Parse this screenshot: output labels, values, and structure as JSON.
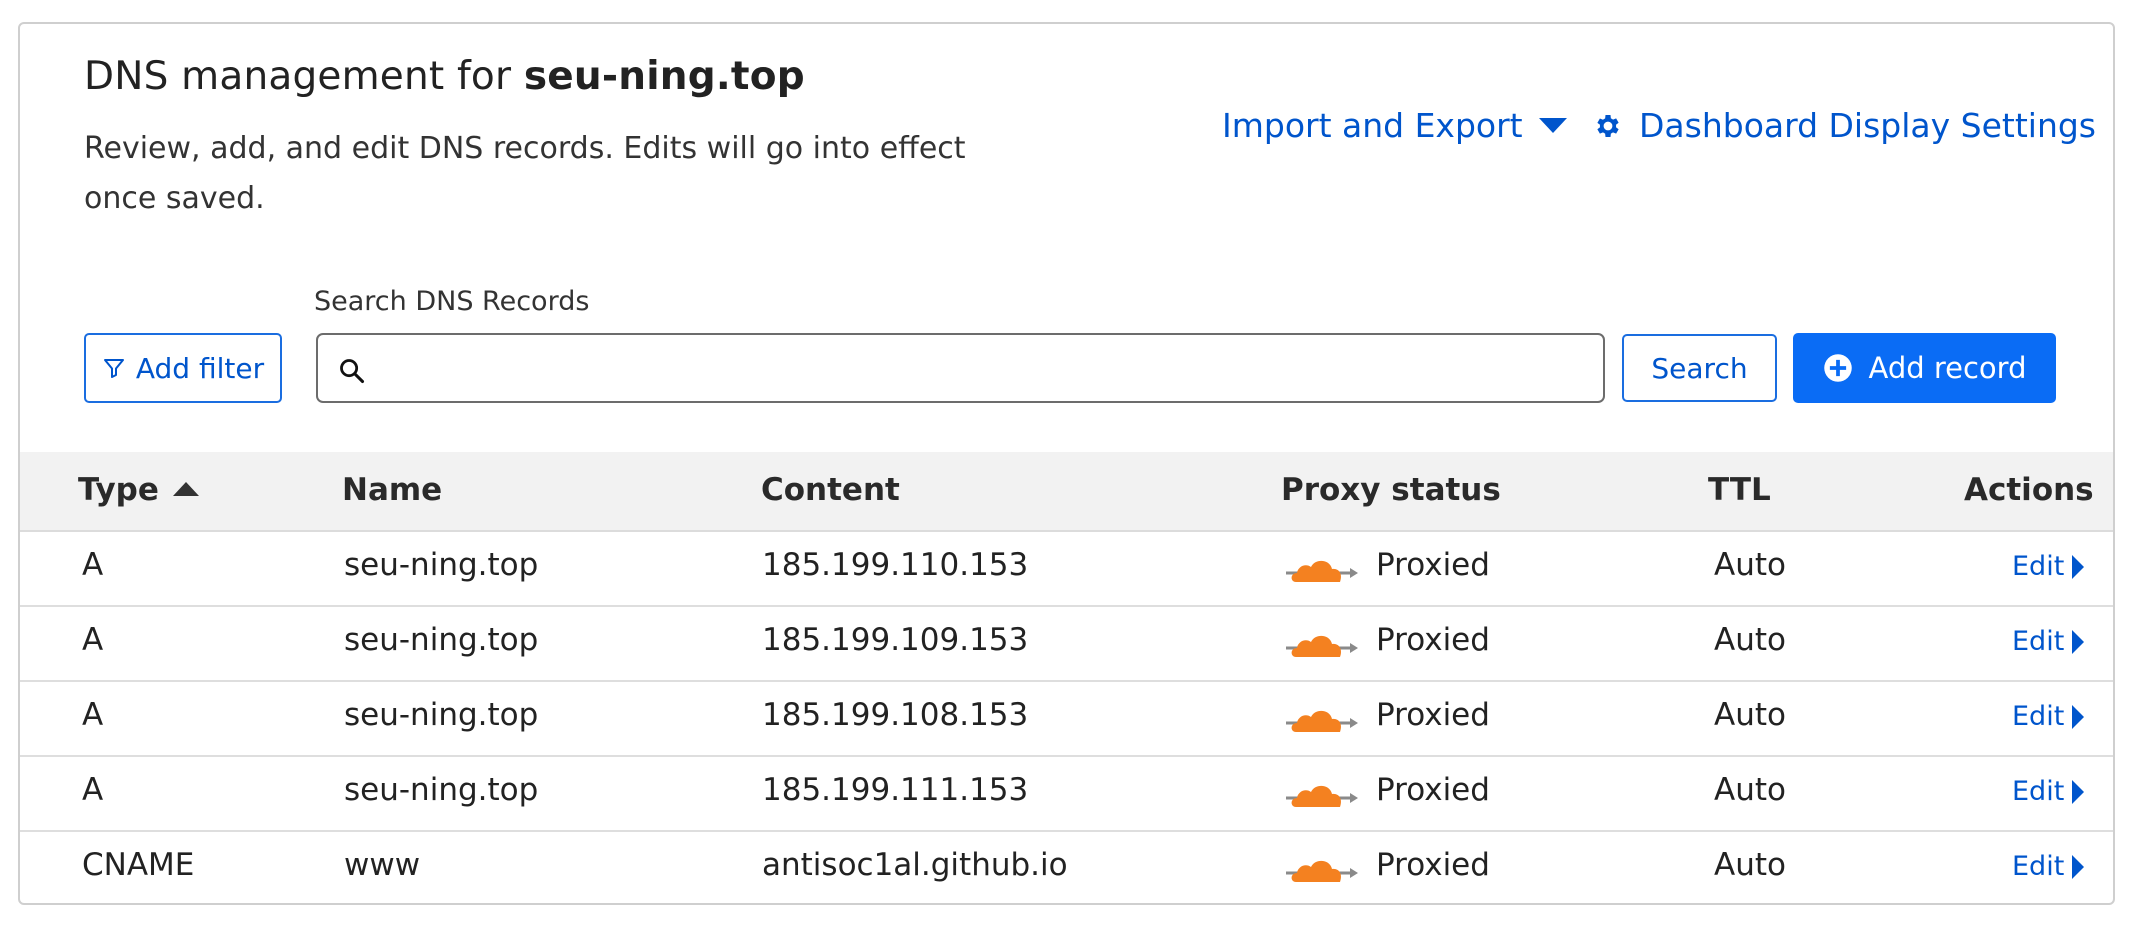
{
  "header": {
    "title_prefix": "DNS management for ",
    "domain": "seu-ning.top",
    "description": "Review, add, and edit DNS records. Edits will go into effect once saved."
  },
  "top_links": {
    "import_export": "Import and Export",
    "dashboard_settings": "Dashboard Display Settings"
  },
  "toolbar": {
    "add_filter": "Add filter",
    "search_label": "Search DNS Records",
    "search_value": "",
    "search_button": "Search",
    "add_record": "Add record"
  },
  "table": {
    "columns": {
      "type": "Type",
      "name": "Name",
      "content": "Content",
      "proxy_status": "Proxy status",
      "ttl": "TTL",
      "actions": "Actions"
    },
    "sort_column": "type",
    "sort_direction": "ascending",
    "rows": [
      {
        "type": "A",
        "name": "seu-ning.top",
        "content": "185.199.110.153",
        "proxy": "Proxied",
        "ttl": "Auto",
        "action": "Edit"
      },
      {
        "type": "A",
        "name": "seu-ning.top",
        "content": "185.199.109.153",
        "proxy": "Proxied",
        "ttl": "Auto",
        "action": "Edit"
      },
      {
        "type": "A",
        "name": "seu-ning.top",
        "content": "185.199.108.153",
        "proxy": "Proxied",
        "ttl": "Auto",
        "action": "Edit"
      },
      {
        "type": "A",
        "name": "seu-ning.top",
        "content": "185.199.111.153",
        "proxy": "Proxied",
        "ttl": "Auto",
        "action": "Edit"
      },
      {
        "type": "CNAME",
        "name": "www",
        "content": "antisoc1al.github.io",
        "proxy": "Proxied",
        "ttl": "Auto",
        "action": "Edit"
      }
    ]
  },
  "icons": {
    "filter": "filter-funnel-icon",
    "search": "magnifier-icon",
    "add": "plus-circle-icon",
    "settings": "gear-icon",
    "dropdown": "caret-down-icon",
    "proxy": "orange-cloud-icon",
    "edit": "caret-right-icon",
    "sort": "sort-ascending-icon"
  },
  "colors": {
    "link_blue": "#0055cc",
    "primary_button": "#0a6cf5",
    "cloud_orange": "#f48120",
    "header_bg": "#f2f2f2"
  }
}
